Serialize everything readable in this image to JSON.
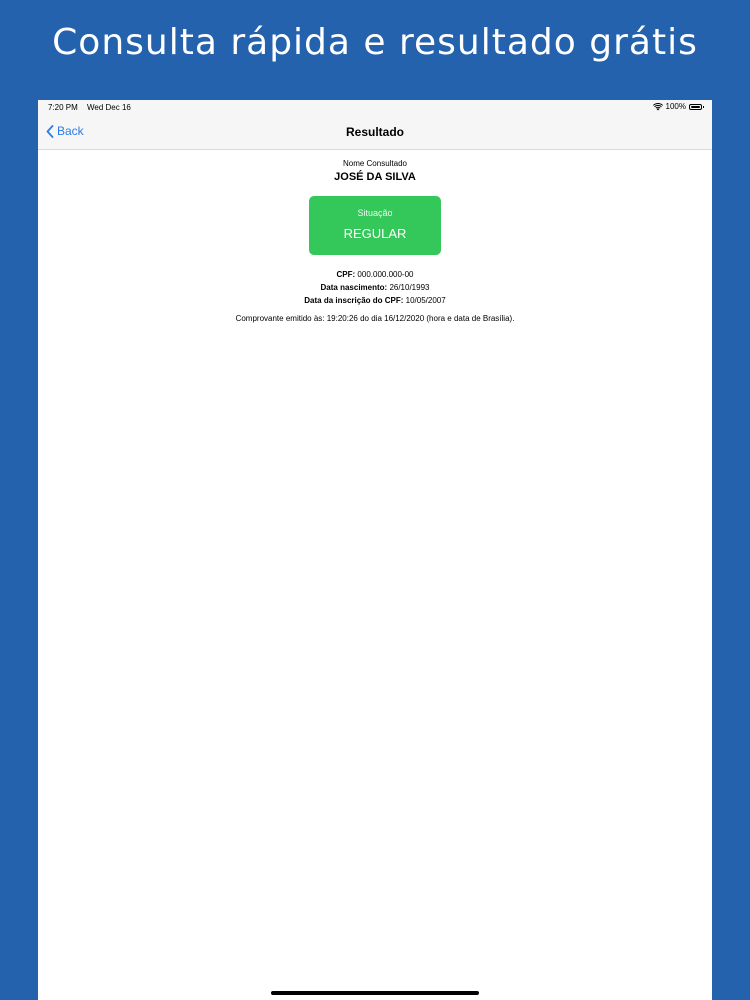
{
  "promo": {
    "title": "Consulta rápida e resultado grátis"
  },
  "status_bar": {
    "time": "7:20 PM",
    "date": "Wed Dec 16",
    "battery": "100%",
    "wifi_icon": "wifi-icon",
    "battery_icon": "battery-icon"
  },
  "nav": {
    "back_label": "Back",
    "back_icon": "chevron-left-icon",
    "title": "Resultado"
  },
  "result": {
    "name_label": "Nome Consultado",
    "name_value": "JOSÉ DA SILVA",
    "situacao_label": "Situação",
    "situacao_value": "REGULAR",
    "cpf_label": "CPF:",
    "cpf_value": "000.000.000-00",
    "birth_label": "Data nascimento:",
    "birth_value": "26/10/1993",
    "inscricao_label": "Data da inscrição do CPF:",
    "inscricao_value": "10/05/2007",
    "receipt_text": "Comprovante emitido às: 19:20:26 do dia 16/12/2020 (hora e data de Brasília)."
  },
  "colors": {
    "background": "#2462ae",
    "status_green": "#34c759",
    "link_blue": "#2a7ce6"
  }
}
